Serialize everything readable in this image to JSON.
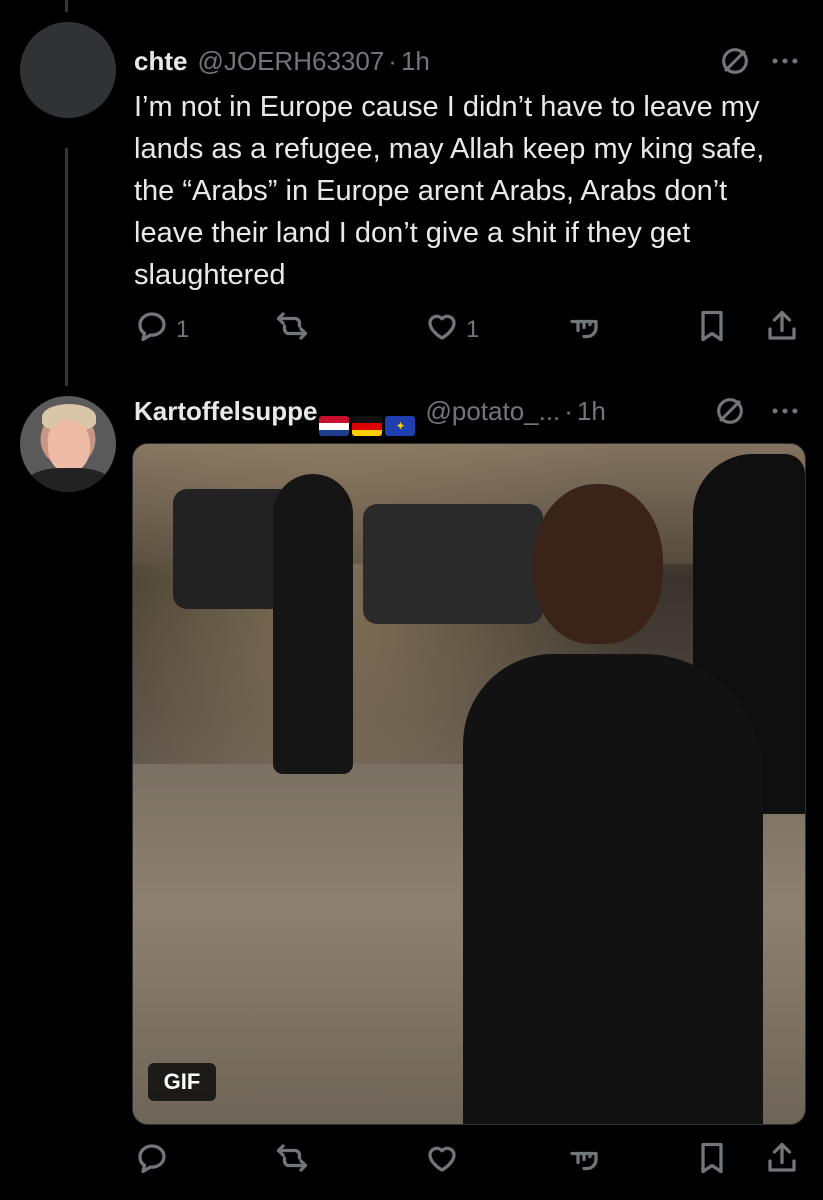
{
  "tweets": [
    {
      "name": "chte",
      "handle": "@JOERH63307",
      "time": "1h",
      "text": "I’m not in Europe cause I didn’t have to leave my lands as a refugee, may Allah keep my king safe, the “Arabs” in Europe arent Arabs, Arabs don’t leave their land I don’t give a shit if they get slaughtered",
      "reply_count": "1",
      "like_count": "1"
    },
    {
      "name": "Kartoffelsuppe",
      "flags": [
        "netherlands-flag",
        "germany-flag",
        "eu-flag"
      ],
      "handle": "@potato_...",
      "time": "1h",
      "media_badge": "GIF"
    }
  ],
  "separator": "·",
  "icons": {
    "grok": "no-sign-icon",
    "more": "more-dots-icon",
    "reply": "reply-icon",
    "retweet": "retweet-icon",
    "like": "heart-icon",
    "views": "views-icon",
    "bookmark": "bookmark-icon",
    "share": "share-icon"
  },
  "colors": {
    "background": "#000000",
    "text": "#e7e9ea",
    "muted": "#71767b"
  }
}
